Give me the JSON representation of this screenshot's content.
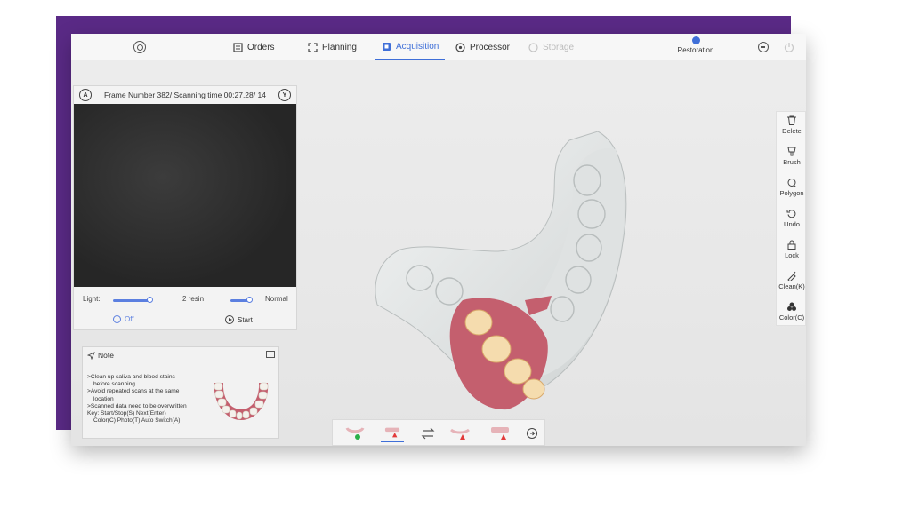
{
  "topbar": {
    "tabs": [
      {
        "label": "Orders",
        "state": "normal"
      },
      {
        "label": "Planning",
        "state": "normal"
      },
      {
        "label": "Acquisition",
        "state": "active"
      },
      {
        "label": "Processor",
        "state": "normal"
      },
      {
        "label": "Storage",
        "state": "disabled"
      }
    ],
    "restoration_label": "Restoration"
  },
  "camera": {
    "left_badge": "A",
    "right_badge": "Y",
    "status": "Frame Number 382/ Scanning time 00:27.28/ 14",
    "light_label": "Light:",
    "light_level": 0.45,
    "resin_label": "2 resin",
    "mode_level": 0.7,
    "mode_label": "Normal",
    "off_label": "Off",
    "start_label": "Start"
  },
  "note": {
    "title": "Note",
    "lines": [
      {
        "text": ">Clean up saliva and blood stains",
        "indent": false
      },
      {
        "text": "before scanning",
        "indent": true
      },
      {
        "text": ">Avoid repeated scans at the same",
        "indent": false
      },
      {
        "text": "location",
        "indent": true
      },
      {
        "text": ">Scanned data need to be overwritten",
        "indent": false
      },
      {
        "text": "Key: Start/Stop(S) Next(Enter)",
        "indent": false
      },
      {
        "text": "Color(C) Photo(T) Auto Switch(A)",
        "indent": true
      }
    ]
  },
  "tools": [
    {
      "label": "Delete",
      "icon": "trash-icon"
    },
    {
      "label": "Brush",
      "icon": "brush-icon"
    },
    {
      "label": "Polygon",
      "icon": "polygon-icon"
    },
    {
      "label": "Undo",
      "icon": "undo-icon"
    },
    {
      "label": "Lock",
      "icon": "lock-icon"
    },
    {
      "label": "Clean(K)",
      "icon": "clean-icon"
    },
    {
      "label": "Color(C)",
      "icon": "color-icon"
    }
  ],
  "steps": [
    {
      "name": "upper-jaw",
      "status": "done"
    },
    {
      "name": "lower-jaw",
      "status": "warning",
      "active": true
    },
    {
      "name": "switch",
      "status": "none"
    },
    {
      "name": "bite-left",
      "status": "warning"
    },
    {
      "name": "bite-right",
      "status": "warning"
    },
    {
      "name": "next",
      "status": "none"
    }
  ],
  "colors": {
    "accent": "#3f6fd8",
    "frame": "#5a2a86",
    "check": "#2bb04a",
    "warning": "#e23b3b",
    "gum": "#c45f6e",
    "tooth": "#e7eaea"
  }
}
